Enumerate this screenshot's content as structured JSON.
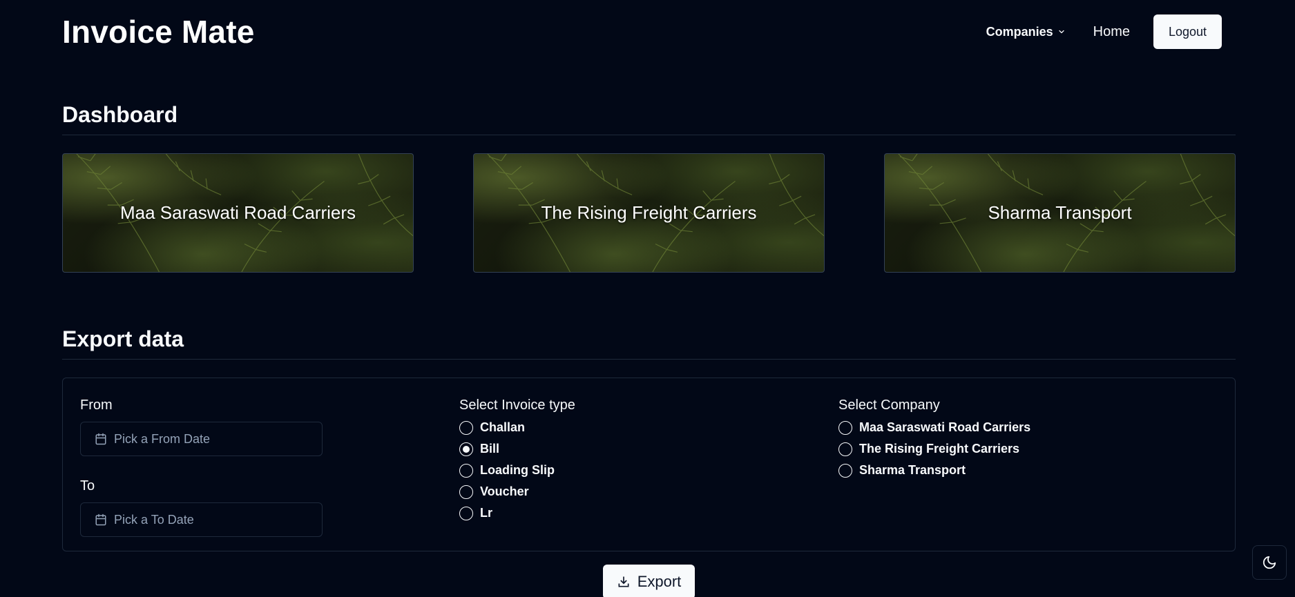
{
  "header": {
    "brand": "Invoice Mate",
    "companies_label": "Companies",
    "home_label": "Home",
    "logout_label": "Logout"
  },
  "dashboard": {
    "title": "Dashboard",
    "cards": [
      {
        "label": "Maa Saraswati Road Carriers"
      },
      {
        "label": "The Rising Freight Carriers"
      },
      {
        "label": "Sharma Transport"
      }
    ]
  },
  "export": {
    "title": "Export data",
    "from_label": "From",
    "from_placeholder": "Pick a From Date",
    "to_label": "To",
    "to_placeholder": "Pick a To Date",
    "invoice_type_label": "Select Invoice type",
    "invoice_types": [
      {
        "label": "Challan",
        "checked": false
      },
      {
        "label": "Bill",
        "checked": true
      },
      {
        "label": "Loading Slip",
        "checked": false
      },
      {
        "label": "Voucher",
        "checked": false
      },
      {
        "label": "Lr",
        "checked": false
      }
    ],
    "company_label": "Select Company",
    "companies": [
      {
        "label": "Maa Saraswati Road Carriers",
        "checked": false
      },
      {
        "label": "The Rising Freight Carriers",
        "checked": false
      },
      {
        "label": "Sharma Transport",
        "checked": false
      }
    ],
    "export_button": "Export"
  },
  "icons": {
    "companies_chevron": "chevron-down-icon",
    "date": "calendar-icon",
    "export": "download-icon",
    "theme": "moon-icon"
  },
  "colors": {
    "background": "#020817",
    "foreground": "#f8fafc",
    "border": "#1e293b",
    "muted": "#94a3b8"
  }
}
